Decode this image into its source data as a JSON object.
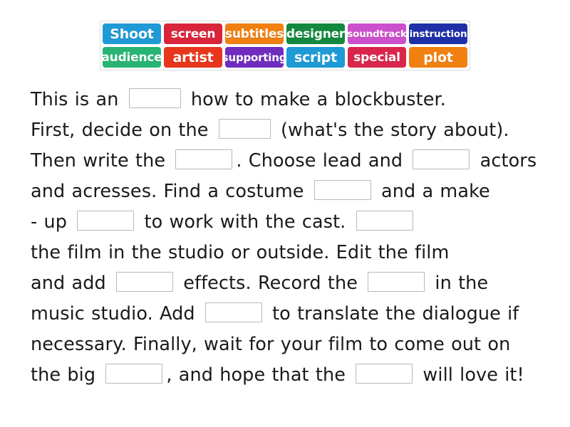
{
  "word_bank": {
    "rows": [
      [
        {
          "label": "Shoot",
          "color": "#1f9ad6",
          "size": "sz-lg"
        },
        {
          "label": "screen",
          "color": "#d9253c",
          "size": "sz-md"
        },
        {
          "label": "subtitles",
          "color": "#f08010",
          "size": "sz-md"
        },
        {
          "label": "designer",
          "color": "#12893e",
          "size": "sz-md"
        },
        {
          "label": "soundtrack",
          "color": "#cc4fcc",
          "size": "sz-xs"
        },
        {
          "label": "instruction",
          "color": "#1e2fa8",
          "size": "sz-xs"
        }
      ],
      [
        {
          "label": "audience",
          "color": "#28b474",
          "size": "sz-md"
        },
        {
          "label": "artist",
          "color": "#e8361c",
          "size": "sz-lg"
        },
        {
          "label": "supporting",
          "color": "#6f2cbf",
          "size": "sz-sm"
        },
        {
          "label": "script",
          "color": "#1f9ad6",
          "size": "sz-lg"
        },
        {
          "label": "special",
          "color": "#d9254c",
          "size": "sz-md"
        },
        {
          "label": "plot",
          "color": "#f08010",
          "size": "sz-lg"
        }
      ]
    ]
  },
  "exercise": {
    "segments": [
      {
        "type": "text",
        "value": "This is an "
      },
      {
        "type": "blank",
        "answer": "instruction",
        "width": "w-narrow"
      },
      {
        "type": "text",
        "value": " how to make a blockbuster."
      },
      {
        "type": "break"
      },
      {
        "type": "text",
        "value": "First, decide on the "
      },
      {
        "type": "blank",
        "answer": "plot",
        "width": "w-narrow"
      },
      {
        "type": "text",
        "value": " (what's the story about)."
      },
      {
        "type": "break"
      },
      {
        "type": "text",
        "value": "Then write the "
      },
      {
        "type": "blank",
        "answer": "script",
        "width": ""
      },
      {
        "type": "text",
        "value": ". Choose lead and "
      },
      {
        "type": "blank",
        "answer": "supporting",
        "width": ""
      },
      {
        "type": "text",
        "value": " actors"
      },
      {
        "type": "break"
      },
      {
        "type": "text",
        "value": "and acresses. Find a costume "
      },
      {
        "type": "blank",
        "answer": "designer",
        "width": ""
      },
      {
        "type": "text",
        "value": " and a make"
      },
      {
        "type": "break"
      },
      {
        "type": "text",
        "value": "- up "
      },
      {
        "type": "blank",
        "answer": "artist",
        "width": ""
      },
      {
        "type": "text",
        "value": " to work with the cast. "
      },
      {
        "type": "blank",
        "answer": "Shoot",
        "width": ""
      },
      {
        "type": "break"
      },
      {
        "type": "text",
        "value": "the film in the studio or outside. Edit the film"
      },
      {
        "type": "break"
      },
      {
        "type": "text",
        "value": "and add "
      },
      {
        "type": "blank",
        "answer": "special",
        "width": ""
      },
      {
        "type": "text",
        "value": " effects. Record the "
      },
      {
        "type": "blank",
        "answer": "soundtrack",
        "width": ""
      },
      {
        "type": "text",
        "value": " in the"
      },
      {
        "type": "break"
      },
      {
        "type": "text",
        "value": "music studio. Add "
      },
      {
        "type": "blank",
        "answer": "subtitles",
        "width": ""
      },
      {
        "type": "text",
        "value": " to translate the dialogue if"
      },
      {
        "type": "break"
      },
      {
        "type": "text",
        "value": "necessary. Finally, wait for your film to come out on"
      },
      {
        "type": "break"
      },
      {
        "type": "text",
        "value": "the big "
      },
      {
        "type": "blank",
        "answer": "screen",
        "width": ""
      },
      {
        "type": "text",
        "value": ", and hope that the "
      },
      {
        "type": "blank",
        "answer": "audience",
        "width": ""
      },
      {
        "type": "text",
        "value": " will love it!"
      }
    ]
  }
}
